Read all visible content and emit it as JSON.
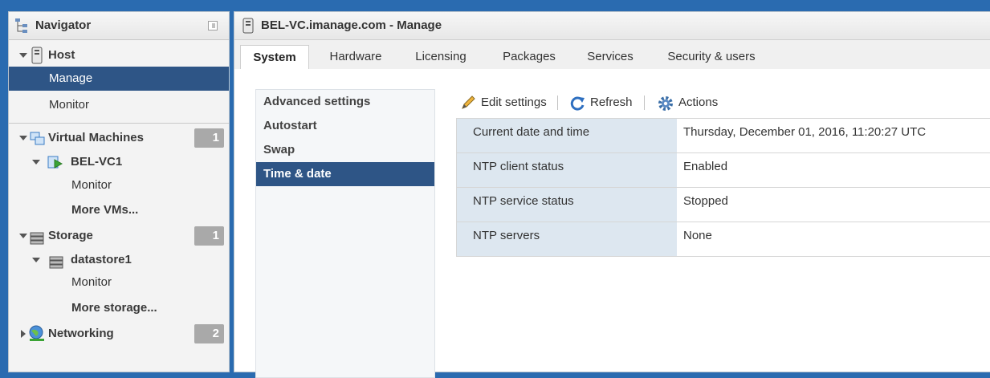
{
  "navigator": {
    "title": "Navigator",
    "host": {
      "label": "Host"
    },
    "host_items": [
      {
        "label": "Manage",
        "selected": true
      },
      {
        "label": "Monitor",
        "selected": false
      }
    ],
    "virtual_machines": {
      "label": "Virtual Machines",
      "count": "1"
    },
    "vm": {
      "label": "BEL-VC1",
      "monitor": "Monitor",
      "more": "More VMs..."
    },
    "storage": {
      "label": "Storage",
      "count": "1"
    },
    "datastore": {
      "label": "datastore1",
      "monitor": "Monitor",
      "more": "More storage..."
    },
    "networking": {
      "label": "Networking",
      "count": "2"
    }
  },
  "main": {
    "title": "BEL-VC.imanage.com - Manage",
    "tabs": [
      {
        "label": "System",
        "active": true
      },
      {
        "label": "Hardware",
        "active": false
      },
      {
        "label": "Licensing",
        "active": false
      },
      {
        "label": "Packages",
        "active": false
      },
      {
        "label": "Services",
        "active": false
      },
      {
        "label": "Security & users",
        "active": false
      }
    ],
    "subnav": [
      {
        "label": "Advanced settings",
        "selected": false
      },
      {
        "label": "Autostart",
        "selected": false
      },
      {
        "label": "Swap",
        "selected": false
      },
      {
        "label": "Time & date",
        "selected": true
      }
    ],
    "toolbar": {
      "edit": "Edit settings",
      "refresh": "Refresh",
      "actions": "Actions"
    },
    "properties": [
      {
        "key": "Current date and time",
        "value": "Thursday, December 01, 2016, 11:20:27 UTC"
      },
      {
        "key": "NTP client status",
        "value": "Enabled"
      },
      {
        "key": "NTP service status",
        "value": "Stopped"
      },
      {
        "key": "NTP servers",
        "value": "None"
      }
    ]
  },
  "colors": {
    "selected_bg": "#2e5586",
    "property_key_bg": "#dde7f0",
    "badge_bg": "#a9a9a9",
    "desktop_bg": "#2a6bb0"
  }
}
